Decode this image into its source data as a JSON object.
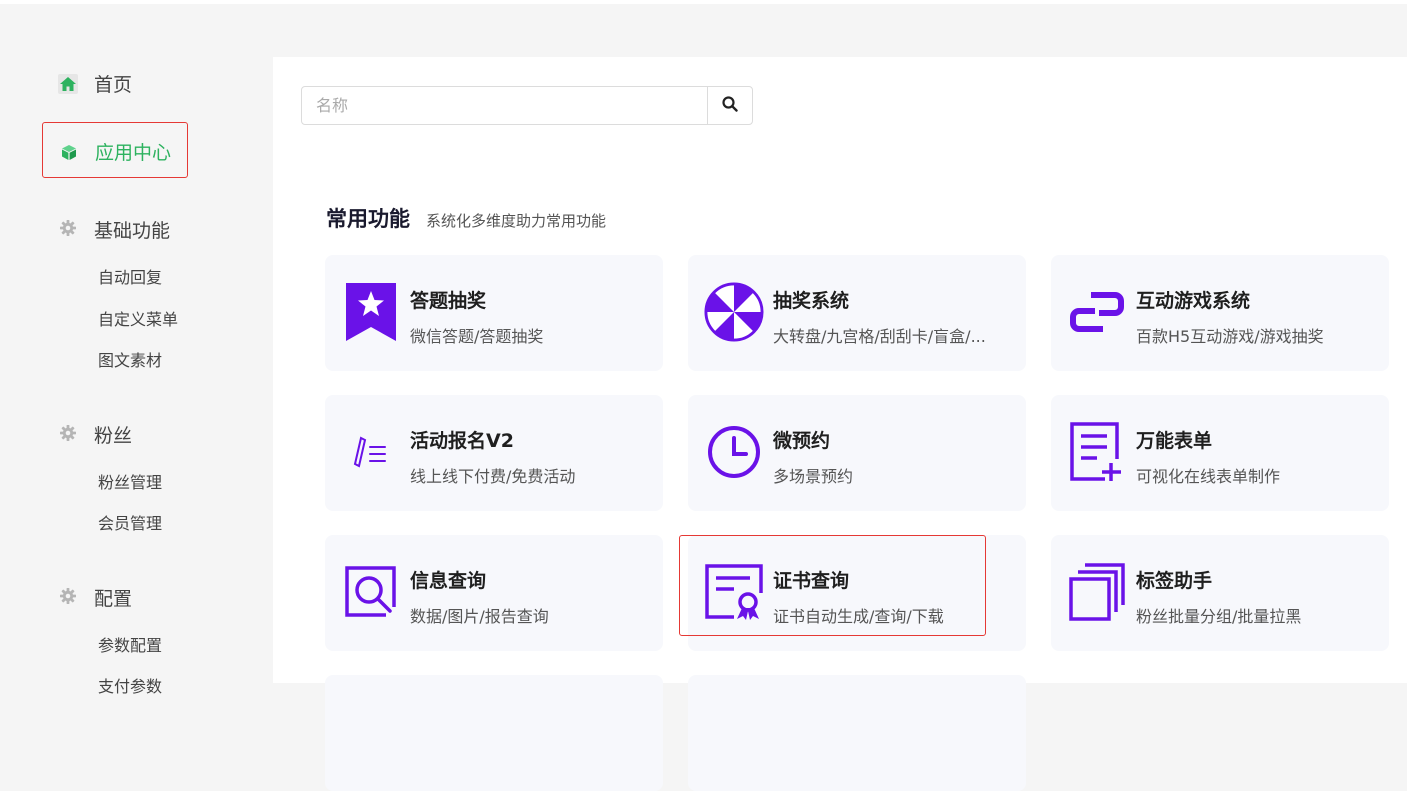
{
  "sidebar": {
    "home": {
      "label": "首页",
      "icon": "home-icon"
    },
    "app_center": {
      "label": "应用中心",
      "icon": "cube-icon",
      "active_color": "#2db25f"
    },
    "groups": [
      {
        "title": "基础功能",
        "icon": "gear-icon",
        "items": [
          "自动回复",
          "自定义菜单",
          "图文素材"
        ]
      },
      {
        "title": "粉丝",
        "icon": "gear-icon",
        "items": [
          "粉丝管理",
          "会员管理"
        ]
      },
      {
        "title": "配置",
        "icon": "gear-icon",
        "items": [
          "参数配置",
          "支付参数"
        ]
      }
    ]
  },
  "search": {
    "placeholder": "名称",
    "button_icon": "search-icon"
  },
  "section": {
    "title": "常用功能",
    "subtitle": "系统化多维度助力常用功能"
  },
  "cards": [
    {
      "title": "答题抽奖",
      "desc": "微信答题/答题抽奖",
      "icon": "bookmark-star-icon"
    },
    {
      "title": "抽奖系统",
      "desc": "大转盘/九宫格/刮刮卡/盲盒/...",
      "icon": "wheel-icon"
    },
    {
      "title": "互动游戏系统",
      "desc": "百款H5互动游戏/游戏抽奖",
      "icon": "link-game-icon"
    },
    {
      "title": "活动报名V2",
      "desc": "线上线下付费/免费活动",
      "icon": "pen-list-icon"
    },
    {
      "title": "微预约",
      "desc": "多场景预约",
      "icon": "clock-icon"
    },
    {
      "title": "万能表单",
      "desc": "可视化在线表单制作",
      "icon": "form-add-icon"
    },
    {
      "title": "信息查询",
      "desc": "数据/图片/报告查询",
      "icon": "search-doc-icon"
    },
    {
      "title": "证书查询",
      "desc": "证书自动生成/查询/下载",
      "icon": "certificate-icon"
    },
    {
      "title": "标签助手",
      "desc": "粉丝批量分组/批量拉黑",
      "icon": "layers-icon"
    }
  ],
  "colors": {
    "accent_purple": "#6a12e8",
    "active_green": "#2db25f",
    "highlight_red": "#e53935"
  }
}
